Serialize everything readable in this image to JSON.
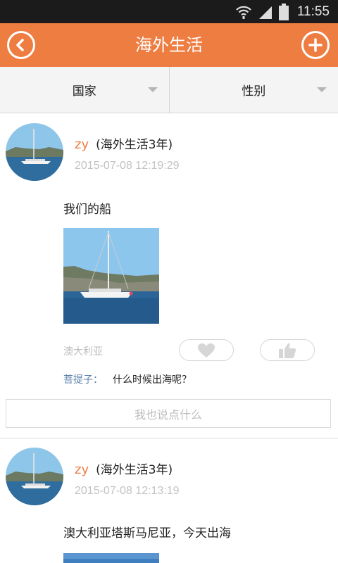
{
  "status_bar": {
    "time": "11:55",
    "icons": [
      "wifi-icon",
      "signal-icon",
      "battery-icon"
    ]
  },
  "header": {
    "title": "海外生活",
    "back_icon": "back-arrow-icon",
    "add_icon": "plus-icon"
  },
  "filters": [
    {
      "label": "国家",
      "icon": "dropdown-arrow-icon"
    },
    {
      "label": "性别",
      "icon": "dropdown-arrow-icon"
    }
  ],
  "posts": [
    {
      "user": "zy",
      "tenure": "(海外生活3年)",
      "time": "2015-07-08 12:19:29",
      "text": "我们的船",
      "location": "澳大利亚",
      "comment": {
        "author": "菩提子：",
        "text": "什么时候出海呢？"
      },
      "reply_placeholder": "我也说点什么"
    },
    {
      "user": "zy",
      "tenure": "(海外生活3年)",
      "time": "2015-07-08 12:13:19",
      "text": "澳大利亚塔斯马尼亚，今天出海"
    }
  ],
  "colors": {
    "accent": "#ee7d42",
    "status_bar": "#1b1b1b",
    "comment_author": "#5a7fa8",
    "muted": "#c2c2c2"
  }
}
